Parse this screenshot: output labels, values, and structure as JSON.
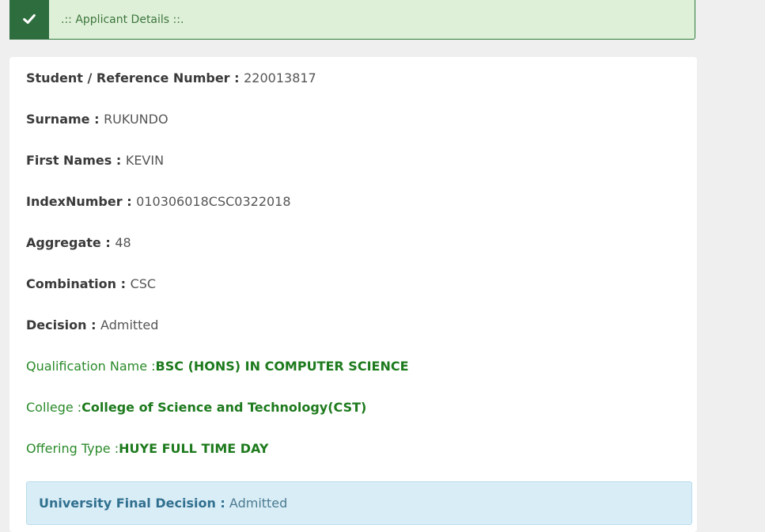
{
  "alert": {
    "title": ".:: Applicant Details ::.",
    "icon": "check-icon",
    "colors": {
      "icon_bg": "#2e6e3e",
      "bg": "#dff0d8",
      "text": "#3c763d"
    }
  },
  "details": {
    "reference": {
      "label": "Student / Reference Number :",
      "value": "220013817"
    },
    "surname": {
      "label": "Surname :",
      "value": "RUKUNDO"
    },
    "first_names": {
      "label": "First Names :",
      "value": "KEVIN"
    },
    "index_number": {
      "label": "IndexNumber :",
      "value": "010306018CSC0322018"
    },
    "aggregate": {
      "label": "Aggregate :",
      "value": "48"
    },
    "combination": {
      "label": "Combination :",
      "value": "CSC"
    },
    "decision": {
      "label": "Decision :",
      "value": "Admitted"
    },
    "qualification": {
      "label": "Qualification Name :",
      "value": "BSC (HONS) IN COMPUTER SCIENCE"
    },
    "college": {
      "label": "College :",
      "value": "College of Science and Technology(CST)"
    },
    "offering_type": {
      "label": "Offering Type :",
      "value": "HUYE FULL TIME DAY"
    }
  },
  "final_decision": {
    "label": "University Final Decision :",
    "value": "Admitted",
    "colors": {
      "bg": "#d9edf7",
      "text": "#31708f"
    }
  }
}
